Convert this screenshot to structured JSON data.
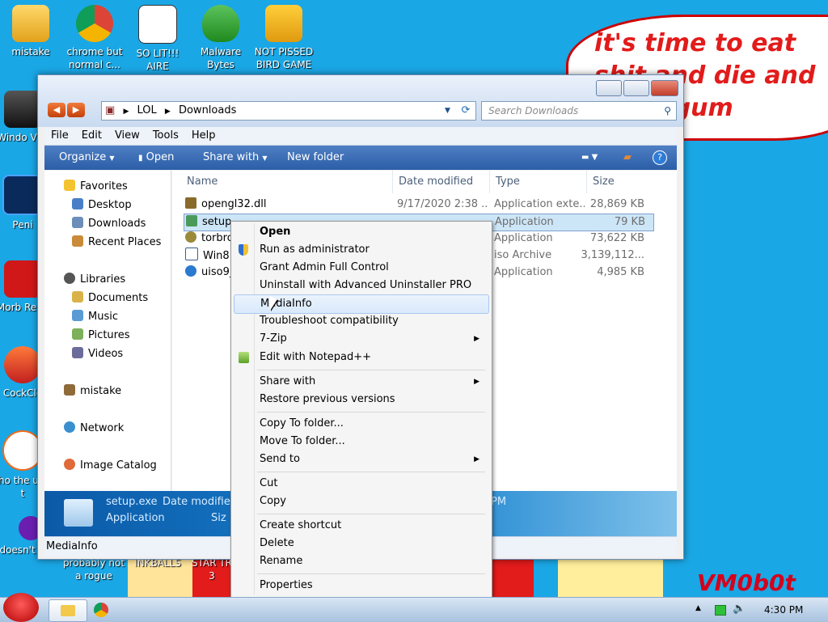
{
  "desktop": {
    "icons": [
      {
        "label": "mistake"
      },
      {
        "label": "chrome but normal c..."
      },
      {
        "label": "SO LIT!!! AIRE"
      },
      {
        "label": "Malware Bytes"
      },
      {
        "label": "NOT PISSED BIRD GAME"
      },
      {
        "label": "Windo Vist"
      },
      {
        "label": "Peni"
      },
      {
        "label": "Morb Read"
      },
      {
        "label": "CockCle"
      },
      {
        "label": "who the uses t"
      },
      {
        "label": "doesn't work lol"
      },
      {
        "label": "probably not a rogue"
      },
      {
        "label": "INKBALLS"
      },
      {
        "label": "STAR TR 3"
      }
    ],
    "speech_text": "it's time to eat shit and die and chew gum",
    "watermark": "VM0b0t"
  },
  "window": {
    "address": {
      "root_icon": "computer-icon",
      "crumbs": [
        "LOL",
        "Downloads"
      ]
    },
    "search_placeholder": "Search Downloads",
    "menu": [
      "File",
      "Edit",
      "View",
      "Tools",
      "Help"
    ],
    "toolbar": {
      "organize": "Organize",
      "open": "Open",
      "share": "Share with",
      "new_folder": "New folder"
    },
    "nav": {
      "favorites": "Favorites",
      "desktop": "Desktop",
      "downloads": "Downloads",
      "recent": "Recent Places",
      "libraries": "Libraries",
      "documents": "Documents",
      "music": "Music",
      "pictures": "Pictures",
      "videos": "Videos",
      "homegroup": "mistake",
      "network": "Network",
      "image_catalog": "Image Catalog"
    },
    "columns": {
      "name": "Name",
      "date": "Date modified",
      "type": "Type",
      "size": "Size"
    },
    "files": [
      {
        "name": "opengl32.dll",
        "date": "9/17/2020 2:38 ...",
        "type": "Application exte...",
        "size": "28,869 KB"
      },
      {
        "name": "setup",
        "date": "",
        "type": "Application",
        "size": "79 KB"
      },
      {
        "name": "torbro",
        "date": "",
        "type": "Application",
        "size": "73,622 KB"
      },
      {
        "name": "Win8.",
        "date": "",
        "type": "iso Archive",
        "size": "3,139,112..."
      },
      {
        "name": "uiso9_",
        "date": "",
        "type": "Application",
        "size": "4,985 KB"
      }
    ],
    "details": {
      "filename": "setup.exe",
      "filetype": "Application",
      "date_label": "Date modified",
      "size_label": "Siz",
      "time_fragment": "PM"
    },
    "status": "MediaInfo"
  },
  "context_menu": {
    "items": [
      {
        "label": "Open",
        "bold": true
      },
      {
        "label": "Run as administrator",
        "icon": "shield-icon"
      },
      {
        "label": "Grant Admin Full Control"
      },
      {
        "label": "Uninstall with Advanced Uninstaller PRO"
      },
      {
        "label": "MediaInfo",
        "highlight": true
      },
      {
        "label": "Troubleshoot compatibility"
      },
      {
        "label": "7-Zip",
        "submenu": true
      },
      {
        "label": "Edit with Notepad++",
        "icon": "notepad-icon"
      },
      {
        "label": "Share with",
        "submenu": true
      },
      {
        "label": "Restore previous versions"
      },
      {
        "label": "Copy To folder..."
      },
      {
        "label": "Move To folder..."
      },
      {
        "label": "Send to",
        "submenu": true
      },
      {
        "label": "Cut"
      },
      {
        "label": "Copy"
      },
      {
        "label": "Create shortcut"
      },
      {
        "label": "Delete"
      },
      {
        "label": "Rename"
      },
      {
        "label": "Properties"
      }
    ]
  },
  "taskbar": {
    "time": "4:30 PM"
  }
}
